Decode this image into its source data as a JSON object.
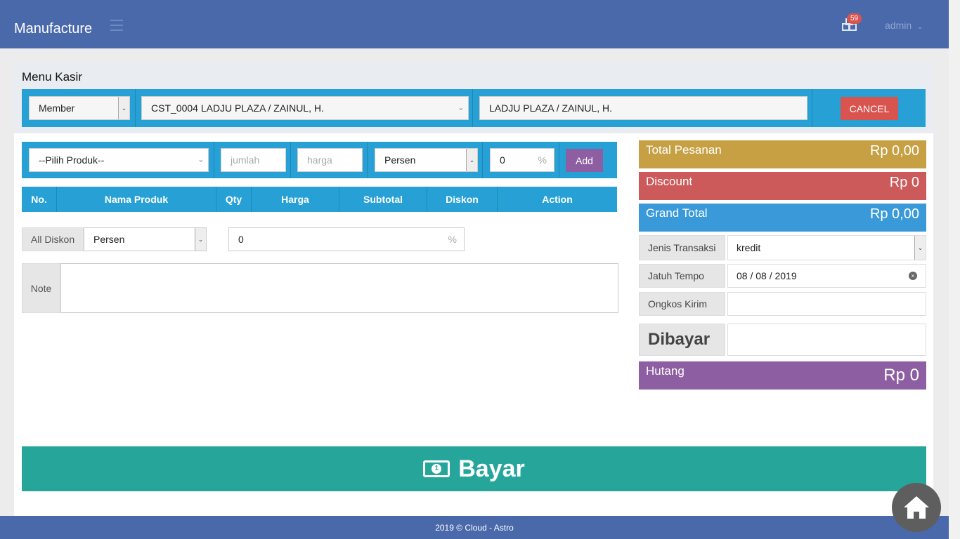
{
  "app": {
    "brand": "Manufacture",
    "notif_count": "59",
    "user": "admin"
  },
  "panel": {
    "title": "Menu Kasir"
  },
  "customer": {
    "type": "Member",
    "customer_select": "CST_0004 LADJU PLAZA / ZAINUL, H.",
    "customer_name": "LADJU PLAZA / ZAINUL, H.",
    "cancel_label": "CANCEL"
  },
  "product_form": {
    "product_select": "--Pilih Produk--",
    "qty_placeholder": "jumlah",
    "price_placeholder": "harga",
    "discount_type": "Persen",
    "discount_value": "0",
    "pct_symbol": "%",
    "add_label": "Add"
  },
  "table": {
    "headers": [
      "No.",
      "Nama Produk",
      "Qty",
      "Harga",
      "Subtotal",
      "Diskon",
      "Action"
    ]
  },
  "all_discount": {
    "label": "All Diskon",
    "type": "Persen",
    "value": "0",
    "pct_symbol": "%"
  },
  "note": {
    "label": "Note",
    "value": ""
  },
  "summary": {
    "total_pesanan_label": "Total Pesanan",
    "total_pesanan_value": "Rp 0,00",
    "discount_label": "Discount",
    "discount_value": "Rp 0",
    "grand_total_label": "Grand Total",
    "grand_total_value": "Rp 0,00",
    "jenis_transaksi_label": "Jenis Transaksi",
    "jenis_transaksi_value": "kredit",
    "jatuh_tempo_label": "Jatuh Tempo",
    "jatuh_tempo_value": "08 / 08 / 2019",
    "ongkos_kirim_label": "Ongkos Kirim",
    "ongkos_kirim_value": "",
    "dibayar_label": "Dibayar",
    "dibayar_value": "",
    "hutang_label": "Hutang",
    "hutang_value": "Rp 0"
  },
  "pay_button": "Bayar",
  "footer": "2019 © Cloud - Astro",
  "colors": {
    "header": "#4a69aa",
    "bar_blue": "#27a1d5",
    "total": "#c6a043",
    "discount": "#cd5a5a",
    "grand": "#3a9ad9",
    "hutang": "#8e5ea2",
    "pay": "#26a69a"
  }
}
